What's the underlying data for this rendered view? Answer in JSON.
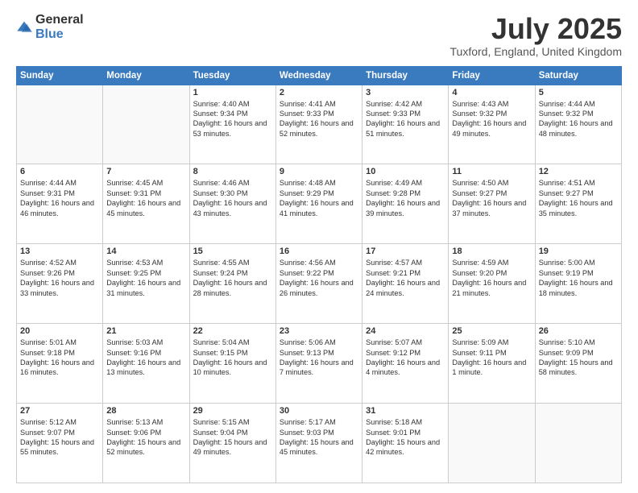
{
  "header": {
    "logo_general": "General",
    "logo_blue": "Blue",
    "month_title": "July 2025",
    "location": "Tuxford, England, United Kingdom"
  },
  "days_of_week": [
    "Sunday",
    "Monday",
    "Tuesday",
    "Wednesday",
    "Thursday",
    "Friday",
    "Saturday"
  ],
  "weeks": [
    [
      {
        "day": "",
        "sunrise": "",
        "sunset": "",
        "daylight": ""
      },
      {
        "day": "",
        "sunrise": "",
        "sunset": "",
        "daylight": ""
      },
      {
        "day": "1",
        "sunrise": "Sunrise: 4:40 AM",
        "sunset": "Sunset: 9:34 PM",
        "daylight": "Daylight: 16 hours and 53 minutes."
      },
      {
        "day": "2",
        "sunrise": "Sunrise: 4:41 AM",
        "sunset": "Sunset: 9:33 PM",
        "daylight": "Daylight: 16 hours and 52 minutes."
      },
      {
        "day": "3",
        "sunrise": "Sunrise: 4:42 AM",
        "sunset": "Sunset: 9:33 PM",
        "daylight": "Daylight: 16 hours and 51 minutes."
      },
      {
        "day": "4",
        "sunrise": "Sunrise: 4:43 AM",
        "sunset": "Sunset: 9:32 PM",
        "daylight": "Daylight: 16 hours and 49 minutes."
      },
      {
        "day": "5",
        "sunrise": "Sunrise: 4:44 AM",
        "sunset": "Sunset: 9:32 PM",
        "daylight": "Daylight: 16 hours and 48 minutes."
      }
    ],
    [
      {
        "day": "6",
        "sunrise": "Sunrise: 4:44 AM",
        "sunset": "Sunset: 9:31 PM",
        "daylight": "Daylight: 16 hours and 46 minutes."
      },
      {
        "day": "7",
        "sunrise": "Sunrise: 4:45 AM",
        "sunset": "Sunset: 9:31 PM",
        "daylight": "Daylight: 16 hours and 45 minutes."
      },
      {
        "day": "8",
        "sunrise": "Sunrise: 4:46 AM",
        "sunset": "Sunset: 9:30 PM",
        "daylight": "Daylight: 16 hours and 43 minutes."
      },
      {
        "day": "9",
        "sunrise": "Sunrise: 4:48 AM",
        "sunset": "Sunset: 9:29 PM",
        "daylight": "Daylight: 16 hours and 41 minutes."
      },
      {
        "day": "10",
        "sunrise": "Sunrise: 4:49 AM",
        "sunset": "Sunset: 9:28 PM",
        "daylight": "Daylight: 16 hours and 39 minutes."
      },
      {
        "day": "11",
        "sunrise": "Sunrise: 4:50 AM",
        "sunset": "Sunset: 9:27 PM",
        "daylight": "Daylight: 16 hours and 37 minutes."
      },
      {
        "day": "12",
        "sunrise": "Sunrise: 4:51 AM",
        "sunset": "Sunset: 9:27 PM",
        "daylight": "Daylight: 16 hours and 35 minutes."
      }
    ],
    [
      {
        "day": "13",
        "sunrise": "Sunrise: 4:52 AM",
        "sunset": "Sunset: 9:26 PM",
        "daylight": "Daylight: 16 hours and 33 minutes."
      },
      {
        "day": "14",
        "sunrise": "Sunrise: 4:53 AM",
        "sunset": "Sunset: 9:25 PM",
        "daylight": "Daylight: 16 hours and 31 minutes."
      },
      {
        "day": "15",
        "sunrise": "Sunrise: 4:55 AM",
        "sunset": "Sunset: 9:24 PM",
        "daylight": "Daylight: 16 hours and 28 minutes."
      },
      {
        "day": "16",
        "sunrise": "Sunrise: 4:56 AM",
        "sunset": "Sunset: 9:22 PM",
        "daylight": "Daylight: 16 hours and 26 minutes."
      },
      {
        "day": "17",
        "sunrise": "Sunrise: 4:57 AM",
        "sunset": "Sunset: 9:21 PM",
        "daylight": "Daylight: 16 hours and 24 minutes."
      },
      {
        "day": "18",
        "sunrise": "Sunrise: 4:59 AM",
        "sunset": "Sunset: 9:20 PM",
        "daylight": "Daylight: 16 hours and 21 minutes."
      },
      {
        "day": "19",
        "sunrise": "Sunrise: 5:00 AM",
        "sunset": "Sunset: 9:19 PM",
        "daylight": "Daylight: 16 hours and 18 minutes."
      }
    ],
    [
      {
        "day": "20",
        "sunrise": "Sunrise: 5:01 AM",
        "sunset": "Sunset: 9:18 PM",
        "daylight": "Daylight: 16 hours and 16 minutes."
      },
      {
        "day": "21",
        "sunrise": "Sunrise: 5:03 AM",
        "sunset": "Sunset: 9:16 PM",
        "daylight": "Daylight: 16 hours and 13 minutes."
      },
      {
        "day": "22",
        "sunrise": "Sunrise: 5:04 AM",
        "sunset": "Sunset: 9:15 PM",
        "daylight": "Daylight: 16 hours and 10 minutes."
      },
      {
        "day": "23",
        "sunrise": "Sunrise: 5:06 AM",
        "sunset": "Sunset: 9:13 PM",
        "daylight": "Daylight: 16 hours and 7 minutes."
      },
      {
        "day": "24",
        "sunrise": "Sunrise: 5:07 AM",
        "sunset": "Sunset: 9:12 PM",
        "daylight": "Daylight: 16 hours and 4 minutes."
      },
      {
        "day": "25",
        "sunrise": "Sunrise: 5:09 AM",
        "sunset": "Sunset: 9:11 PM",
        "daylight": "Daylight: 16 hours and 1 minute."
      },
      {
        "day": "26",
        "sunrise": "Sunrise: 5:10 AM",
        "sunset": "Sunset: 9:09 PM",
        "daylight": "Daylight: 15 hours and 58 minutes."
      }
    ],
    [
      {
        "day": "27",
        "sunrise": "Sunrise: 5:12 AM",
        "sunset": "Sunset: 9:07 PM",
        "daylight": "Daylight: 15 hours and 55 minutes."
      },
      {
        "day": "28",
        "sunrise": "Sunrise: 5:13 AM",
        "sunset": "Sunset: 9:06 PM",
        "daylight": "Daylight: 15 hours and 52 minutes."
      },
      {
        "day": "29",
        "sunrise": "Sunrise: 5:15 AM",
        "sunset": "Sunset: 9:04 PM",
        "daylight": "Daylight: 15 hours and 49 minutes."
      },
      {
        "day": "30",
        "sunrise": "Sunrise: 5:17 AM",
        "sunset": "Sunset: 9:03 PM",
        "daylight": "Daylight: 15 hours and 45 minutes."
      },
      {
        "day": "31",
        "sunrise": "Sunrise: 5:18 AM",
        "sunset": "Sunset: 9:01 PM",
        "daylight": "Daylight: 15 hours and 42 minutes."
      },
      {
        "day": "",
        "sunrise": "",
        "sunset": "",
        "daylight": ""
      },
      {
        "day": "",
        "sunrise": "",
        "sunset": "",
        "daylight": ""
      }
    ]
  ]
}
